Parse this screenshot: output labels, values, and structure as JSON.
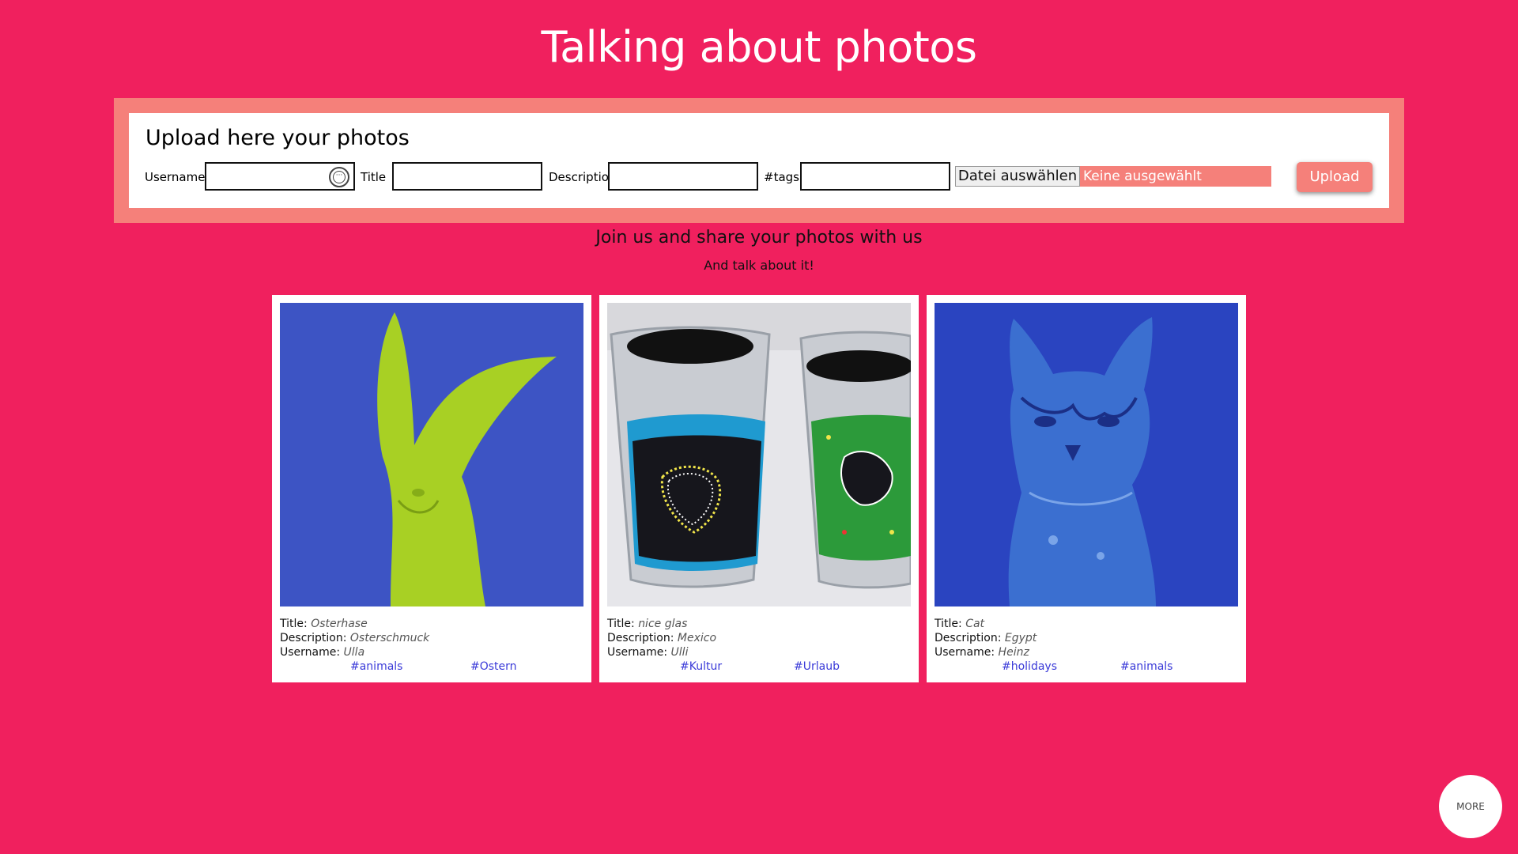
{
  "page": {
    "title": "Talking about photos",
    "tagline": "Join us and share your photos with us",
    "subtagline": "And talk about it!"
  },
  "upload": {
    "heading": "Upload here your photos",
    "username_label": "Username",
    "title_label": "Title",
    "description_label": "Description",
    "tags_label": "#tags",
    "username_value": "",
    "title_value": "",
    "description_value": "",
    "tags_value": "",
    "file_button_label": "Datei auswählen",
    "file_status": "Keine ausgewählt",
    "submit_label": "Upload"
  },
  "cards": [
    {
      "title_label": "Title:",
      "title": "Osterhase",
      "description_label": "Description:",
      "description": "Osterschmuck",
      "username_label": "Username:",
      "username": "Ulla",
      "tags": [
        "#animals",
        "#Ostern"
      ]
    },
    {
      "title_label": "Title:",
      "title": "nice glas",
      "description_label": "Description:",
      "description": "Mexico",
      "username_label": "Username:",
      "username": "Ulli",
      "tags": [
        "#Kultur",
        "#Urlaub"
      ]
    },
    {
      "title_label": "Title:",
      "title": "Cat",
      "description_label": "Description:",
      "description": "Egypt",
      "username_label": "Username:",
      "username": "Heinz",
      "tags": [
        "#holidays",
        "#animals"
      ]
    }
  ],
  "more_button_label": "MORE",
  "colors": {
    "background": "#f0205e",
    "accent": "#f5807a",
    "tag_link": "#3a3ad8"
  }
}
